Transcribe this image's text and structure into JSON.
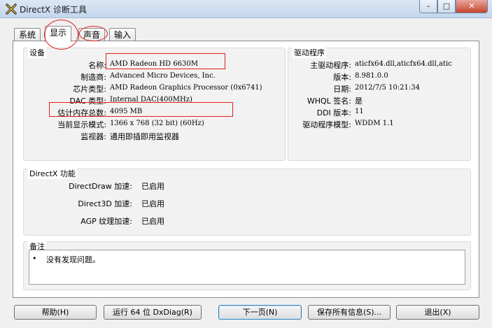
{
  "window": {
    "title": "DirectX 诊断工具",
    "min": "–",
    "max": "□",
    "close": "✕"
  },
  "tabs": [
    {
      "label": "系统"
    },
    {
      "label": "显示"
    },
    {
      "label": "声音"
    },
    {
      "label": "输入"
    }
  ],
  "device": {
    "title": "设备",
    "rows": [
      {
        "label": "名称:",
        "value": "AMD Radeon HD 6630M"
      },
      {
        "label": "制造商:",
        "value": "Advanced Micro Devices, Inc."
      },
      {
        "label": "芯片类型:",
        "value": "AMD Radeon Graphics Processor (0x6741)"
      },
      {
        "label": "DAC 类型:",
        "value": "Internal DAC(400MHz)"
      },
      {
        "label": "估计内存总数:",
        "value": "4095 MB"
      },
      {
        "label": "当前显示模式:",
        "value": "1366 x 768 (32 bit) (60Hz)"
      },
      {
        "label": "监视器:",
        "value": "通用即插即用监视器"
      }
    ]
  },
  "driver": {
    "title": "驱动程序",
    "rows": [
      {
        "label": "主驱动程序:",
        "value": "aticfx64.dll,aticfx64.dll,atic"
      },
      {
        "label": "版本:",
        "value": "8.981.0.0"
      },
      {
        "label": "日期:",
        "value": "2012/7/5 10:21:34"
      },
      {
        "label": "WHQL 签名:",
        "value": "是"
      },
      {
        "label": "DDI 版本:",
        "value": "11"
      },
      {
        "label": "驱动程序模型:",
        "value": "WDDM 1.1"
      }
    ]
  },
  "directx": {
    "title": "DirectX 功能",
    "rows": [
      {
        "label": "DirectDraw 加速:",
        "value": "已启用"
      },
      {
        "label": "Direct3D 加速:",
        "value": "已启用"
      },
      {
        "label": "AGP 纹理加速:",
        "value": "已启用"
      }
    ]
  },
  "notes": {
    "title": "备注",
    "items": [
      "没有发现问题。"
    ]
  },
  "buttons": {
    "help": "帮助(H)",
    "run64": "运行 64 位 DxDiag(R)",
    "next": "下一页(N)",
    "save": "保存所有信息(S)...",
    "exit": "退出(X)"
  }
}
